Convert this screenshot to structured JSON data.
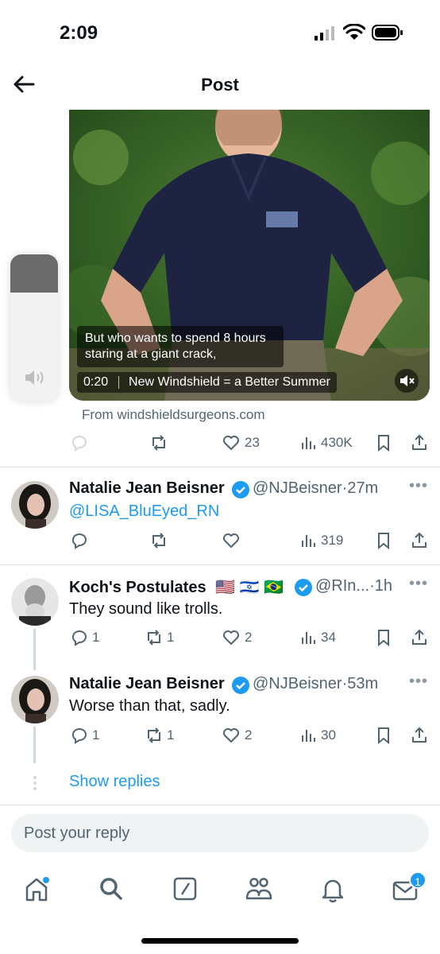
{
  "status_bar": {
    "time": "2:09"
  },
  "header": {
    "title": "Post"
  },
  "video": {
    "caption": "But who wants to spend 8 hours staring at a giant crack,",
    "time": "0:20",
    "video_title": "New Windshield = a Better Summer",
    "volume_level": 0.26
  },
  "main_post": {
    "source": "From windshieldsurgeons.com",
    "likes": "23",
    "views": "430K"
  },
  "replies": [
    {
      "name": "Natalie Jean Beisner",
      "handle": "@NJBeisner",
      "time": "27m",
      "text": "@LISA_BluEyed_RN",
      "replies": "",
      "reposts": "",
      "likes": "",
      "views": "319"
    },
    {
      "name": "Koch's Postulates",
      "flags": "🇺🇸 🇮🇱 🇧🇷",
      "handle": "@RIn...",
      "time": "1h",
      "text": "They sound like trolls.",
      "replies": "1",
      "reposts": "1",
      "likes": "2",
      "views": "34"
    },
    {
      "name": "Natalie Jean Beisner",
      "handle": "@NJBeisner",
      "time": "53m",
      "text": "Worse than that, sadly.",
      "replies": "1",
      "reposts": "1",
      "likes": "2",
      "views": "30"
    }
  ],
  "show_replies": "Show replies",
  "reply_box": {
    "placeholder": "Post your reply"
  },
  "nav": {
    "items": [
      "home-icon",
      "search-icon",
      "grok-icon",
      "communities-icon",
      "notifications-icon",
      "messages-icon"
    ],
    "messages_badge": "1"
  },
  "colors": {
    "accent": "#1d9bf0",
    "muted": "#536471"
  }
}
